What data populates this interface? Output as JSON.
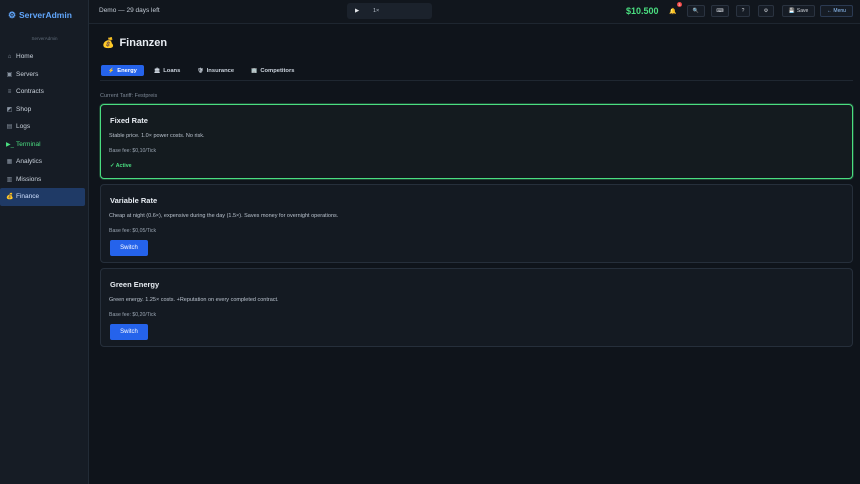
{
  "sidebar": {
    "brand": "ServerAdmin",
    "brand_icon": "gear-icon",
    "subtitle": "ServerAdmin",
    "items": [
      {
        "label": "Home",
        "icon": "home-icon",
        "glyph": "⌂"
      },
      {
        "label": "Servers",
        "icon": "server-icon",
        "glyph": "▣"
      },
      {
        "label": "Contracts",
        "icon": "contract-icon",
        "glyph": "≡"
      },
      {
        "label": "Shop",
        "icon": "shop-icon",
        "glyph": "◩"
      },
      {
        "label": "Logs",
        "icon": "logs-icon",
        "glyph": "▤"
      },
      {
        "label": "Terminal",
        "icon": "terminal-icon",
        "glyph": "▶_"
      },
      {
        "label": "Analytics",
        "icon": "analytics-icon",
        "glyph": "▦"
      },
      {
        "label": "Missions",
        "icon": "missions-icon",
        "glyph": "▥"
      },
      {
        "label": "Finance",
        "icon": "money-bag-icon",
        "glyph": "💰"
      }
    ]
  },
  "topbar": {
    "demo_text": "Demo — 29 days left",
    "speed_label": "1×",
    "money": "$10.500",
    "notification_count": "3",
    "save_label": "Save",
    "menu_label": "← Menu",
    "help_label": "?"
  },
  "page": {
    "title": "Finanzen",
    "title_icon": "money-bag-icon",
    "tabs": [
      {
        "label": "Energy",
        "icon": "lightning-icon",
        "glyph": "⚡"
      },
      {
        "label": "Loans",
        "icon": "bank-icon",
        "glyph": "🏛"
      },
      {
        "label": "Insurance",
        "icon": "shield-icon",
        "glyph": "🛡"
      },
      {
        "label": "Competitors",
        "icon": "building-icon",
        "glyph": "🏢"
      }
    ],
    "current_tariff": "Current Tariff: Festpreis"
  },
  "tariffs": [
    {
      "name": "Fixed Rate",
      "description": "Stable price. 1.0× power costs. No risk.",
      "fee": "Base fee: $0,10/Tick",
      "status": "✓ Active"
    },
    {
      "name": "Variable Rate",
      "description": "Cheap at night (0.6×), expensive during the day (1.5×). Saves money for overnight operations.",
      "fee": "Base fee: $0,05/Tick",
      "button": "Switch"
    },
    {
      "name": "Green Energy",
      "description": "Green energy. 1.25× costs. +Reputation on every completed contract.",
      "fee": "Base fee: $0,20/Tick",
      "button": "Switch"
    }
  ],
  "colors": {
    "accent": "#2563eb",
    "money": "#4ade80",
    "brand": "#60a5fa",
    "active_border": "#4ade80"
  }
}
